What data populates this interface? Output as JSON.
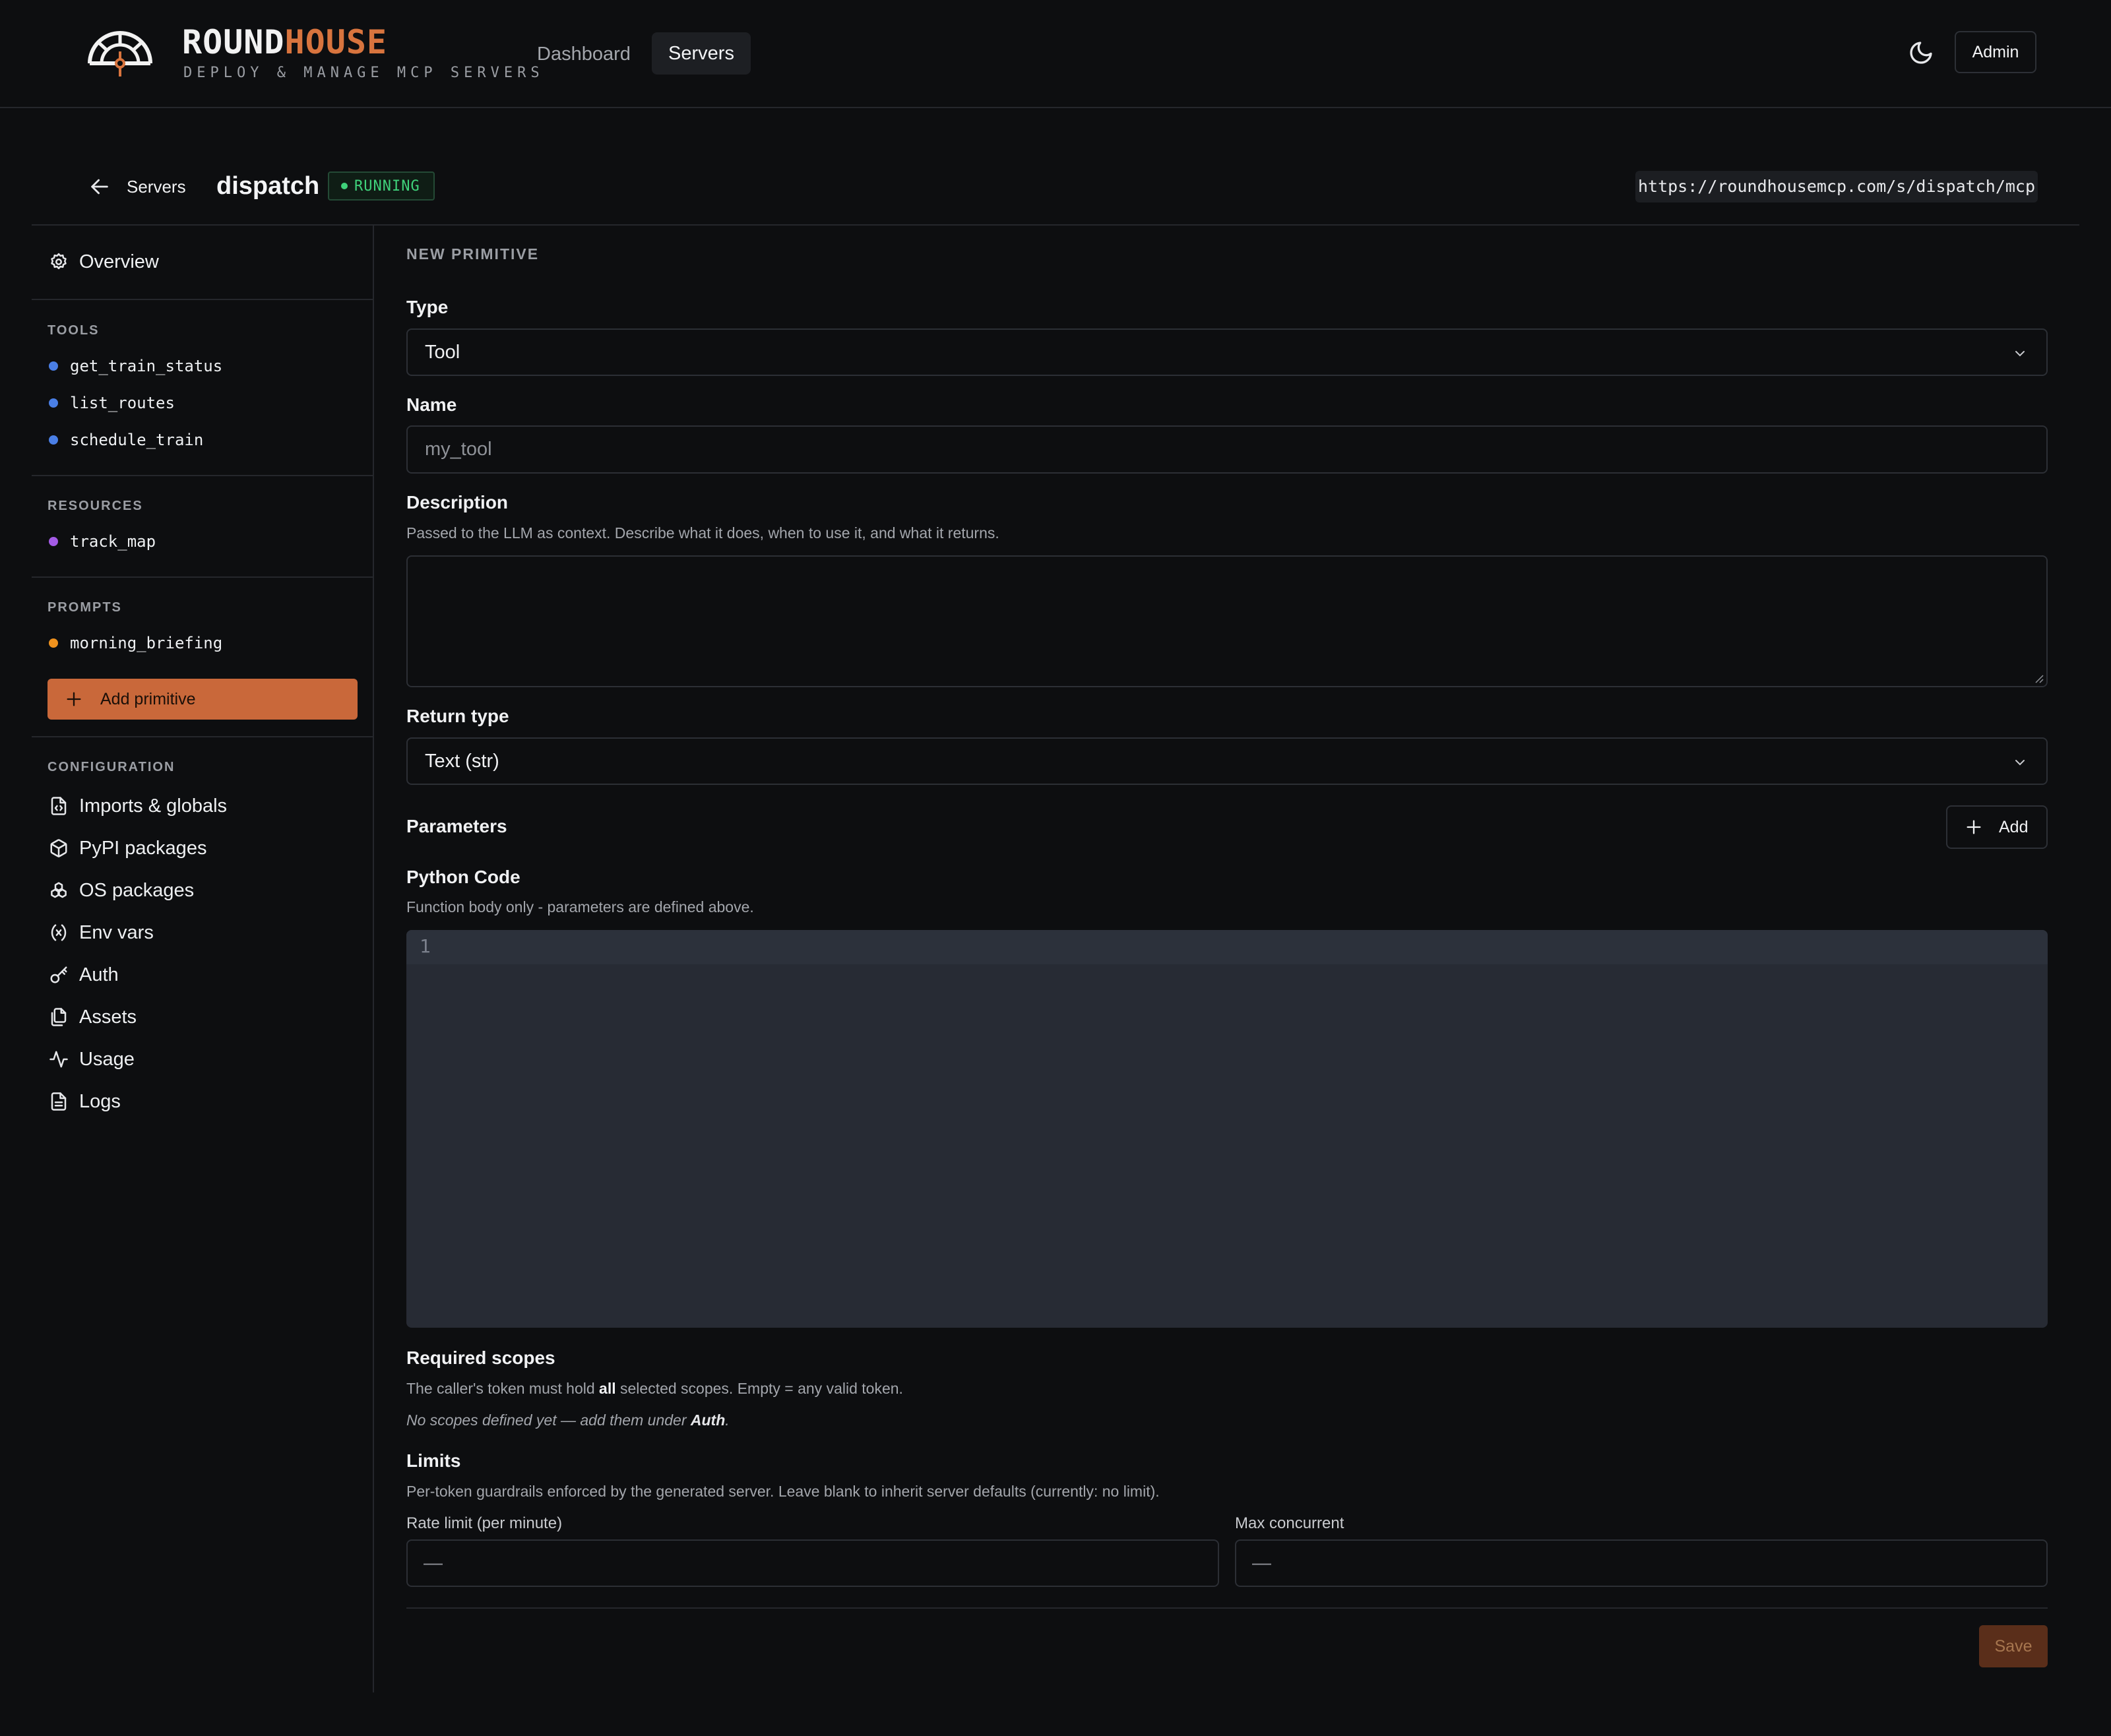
{
  "header": {
    "brand_part1": "ROUND",
    "brand_part2": "HOUSE",
    "tagline": "DEPLOY & MANAGE MCP SERVERS",
    "nav": [
      "Dashboard",
      "Servers"
    ],
    "active_nav": "Servers",
    "admin_label": "Admin",
    "icons": [
      "roundhouse-logo-icon",
      "moon-icon"
    ]
  },
  "page_header": {
    "breadcrumb": "Servers",
    "server_name": "dispatch",
    "status": "RUNNING",
    "status_color": "#3fd17a",
    "url": "https://roundhousemcp.com/s/dispatch/mcp"
  },
  "sidebar": {
    "overview": "Overview",
    "tools_label": "TOOLS",
    "tools": [
      "get_train_status",
      "list_routes",
      "schedule_train"
    ],
    "tools_color": "#4a7fe6",
    "resources_label": "RESOURCES",
    "resources": [
      "track_map"
    ],
    "resources_color": "#a45be6",
    "prompts_label": "PROMPTS",
    "prompts": [
      "morning_briefing"
    ],
    "prompts_color": "#f0921e",
    "add_primitive": "Add primitive",
    "config_label": "CONFIGURATION",
    "config_items": [
      "Imports & globals",
      "PyPI packages",
      "OS packages",
      "Env vars",
      "Auth",
      "Assets",
      "Usage",
      "Logs"
    ]
  },
  "form": {
    "heading": "NEW PRIMITIVE",
    "type_label": "Type",
    "type_value": "Tool",
    "name_label": "Name",
    "name_placeholder": "my_tool",
    "description_label": "Description",
    "description_help": "Passed to the LLM as context. Describe what it does, when to use it, and what it returns.",
    "description_value": "",
    "return_label": "Return type",
    "return_value": "Text (str)",
    "params_label": "Parameters",
    "params_add": "Add",
    "code_label": "Python Code",
    "code_help": "Function body only - parameters are defined above.",
    "code_line_number": "1",
    "scopes_label": "Required scopes",
    "scopes_help_1": "The caller's token must hold ",
    "scopes_help_bold": "all",
    "scopes_help_2": " selected scopes. Empty = any valid token.",
    "scopes_empty_1": "No scopes defined yet — add them under ",
    "scopes_empty_bold": "Auth",
    "scopes_empty_2": ".",
    "limits_label": "Limits",
    "limits_help": "Per-token guardrails enforced by the generated server. Leave blank to inherit server defaults (currently: no limit).",
    "rate_label": "Rate limit (per minute)",
    "rate_placeholder": "—",
    "concurrent_label": "Max concurrent",
    "concurrent_placeholder": "—",
    "save_label": "Save"
  },
  "colors": {
    "accent": "#c9683a",
    "background": "#0d0e10"
  }
}
